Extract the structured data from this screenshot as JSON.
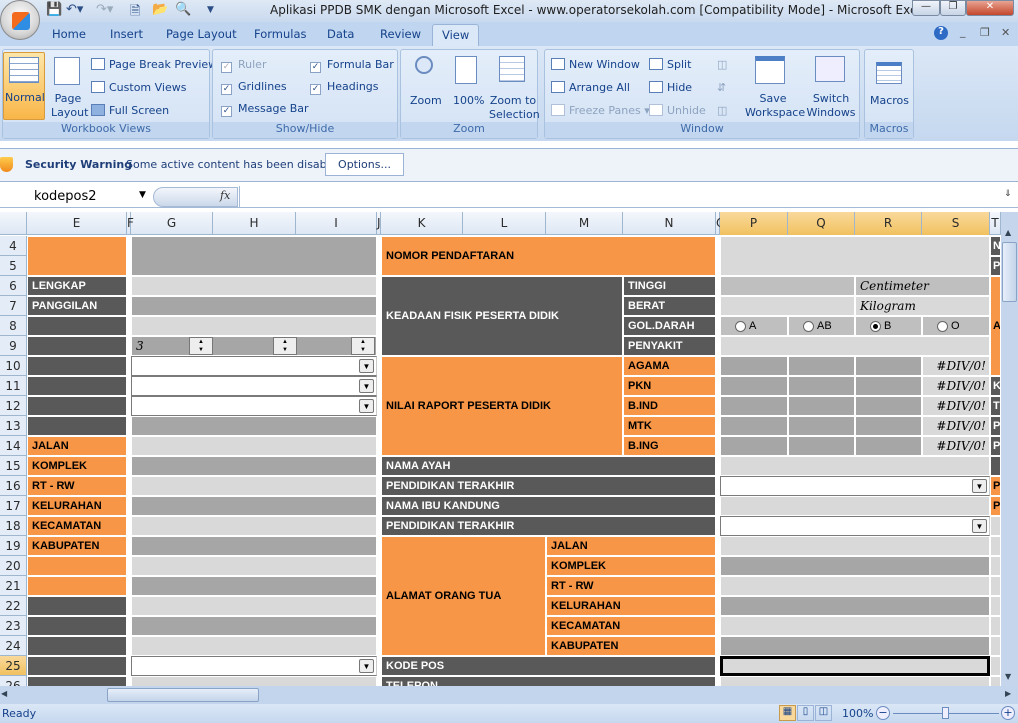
{
  "window": {
    "title": "Aplikasi PPDB SMK dengan Microsoft Excel - www.operatorsekolah.com  [Compatibility Mode] - Microsoft Excel"
  },
  "tabs": [
    "Home",
    "Insert",
    "Page Layout",
    "Formulas",
    "Data",
    "Review",
    "View"
  ],
  "active_tab": "View",
  "ribbon": {
    "workbook_views": {
      "label": "Workbook Views",
      "normal": "Normal",
      "page_layout": "Page Layout",
      "page_break_preview": "Page Break Preview",
      "custom_views": "Custom Views",
      "full_screen": "Full Screen"
    },
    "show_hide": {
      "label": "Show/Hide",
      "ruler": "Ruler",
      "gridlines": "Gridlines",
      "message_bar": "Message Bar",
      "formula_bar": "Formula Bar",
      "headings": "Headings",
      "ruler_checked": true,
      "gridlines_checked": true,
      "message_bar_checked": true,
      "formula_bar_checked": true,
      "headings_checked": true
    },
    "zoom": {
      "label": "Zoom",
      "zoom": "Zoom",
      "hundred": "100%",
      "zoom_to_selection": "Zoom to Selection"
    },
    "window": {
      "label": "Window",
      "new_window": "New Window",
      "arrange_all": "Arrange All",
      "freeze_panes": "Freeze Panes",
      "split": "Split",
      "hide": "Hide",
      "unhide": "Unhide",
      "save_workspace": "Save Workspace",
      "switch_windows": "Switch Windows"
    },
    "macros": {
      "label": "Macros",
      "macros": "Macros"
    }
  },
  "message_bar": {
    "title": "Security Warning",
    "text": "Some active content has been disabled.",
    "options": "Options..."
  },
  "formula_bar": {
    "name_box": "kodepos2",
    "fx": "fx",
    "value": ""
  },
  "columns": [
    "E",
    "F",
    "G",
    "H",
    "I",
    "J",
    "K",
    "L",
    "M",
    "N",
    "O",
    "P",
    "Q",
    "R",
    "S",
    "T"
  ],
  "rows": [
    "4",
    "5",
    "6",
    "7",
    "8",
    "9",
    "10",
    "11",
    "12",
    "13",
    "14",
    "15",
    "16",
    "17",
    "18",
    "19",
    "20",
    "21",
    "22",
    "23",
    "24",
    "25",
    "26"
  ],
  "selected_row": "25",
  "sheet": {
    "E": {
      "lengkap": "LENGKAP",
      "panggilan": "PANGGILAN",
      "jalan": "JALAN",
      "komplek": "KOMPLEK",
      "rtrw": "RT - RW",
      "kelurahan": "KELURAHAN",
      "kecamatan": "KECAMATAN",
      "kabupaten": "KABUPATEN"
    },
    "G9_value": "3",
    "K": {
      "nomor": "NOMOR PENDAFTARAN",
      "keadaan": "KEADAAN FISIK PESERTA DIDIK",
      "nilai": "NILAI RAPORT PESERTA DIDIK",
      "nama_ayah": "NAMA AYAH",
      "pend1": "PENDIDIKAN TERAKHIR",
      "nama_ibu": "NAMA IBU KANDUNG",
      "pend2": "PENDIDIKAN TERAKHIR",
      "alamat": "ALAMAT ORANG TUA",
      "kode_pos": "KODE POS",
      "telepon": "TELEPON"
    },
    "N": {
      "tinggi": "TINGGI",
      "berat": "BERAT",
      "goldarah": "GOL.DARAH",
      "penyakit": "PENYAKIT",
      "agama": "AGAMA",
      "pkn": "PKN",
      "bind": "B.IND",
      "mtk": "MTK",
      "bing": "B.ING"
    },
    "M": {
      "jalan": "JALAN",
      "komplek": "KOMPLEK",
      "rtrw": "RT - RW",
      "kelurahan": "KELURAHAN",
      "kecamatan": "KECAMATAN",
      "kabupaten": "KABUPATEN"
    },
    "P": {
      "centimeter": "Centimeter",
      "kilogram": "Kilogram",
      "blood_options": [
        "A",
        "AB",
        "B",
        "O"
      ],
      "blood_selected": "B",
      "div_errors": [
        "#DIV/0!",
        "#DIV/0!",
        "#DIV/0!",
        "#DIV/0!",
        "#DIV/0!"
      ]
    },
    "T": {
      "r4": "N",
      "r5": "P",
      "r9": "A",
      "r11": "K",
      "r12": "T",
      "r13": "P",
      "r14": "P",
      "r16": "P",
      "r17": "P"
    }
  },
  "status": {
    "text": "Ready",
    "zoom": "100%",
    "zoom_level": 100
  },
  "colors": {
    "orange": "#F79646",
    "dark": "#595959",
    "medium": "#A6A6A6",
    "light": "#D9D9D9"
  }
}
